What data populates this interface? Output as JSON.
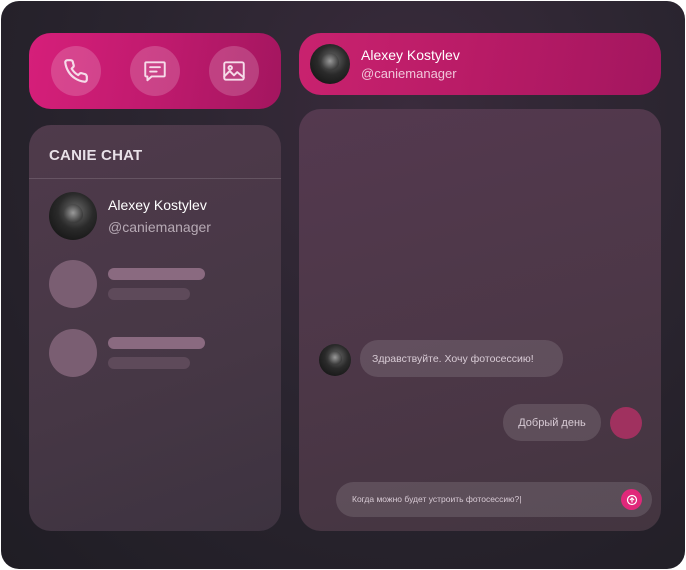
{
  "colors": {
    "accent": "#d61f7a",
    "send": "#e0287a",
    "panel": "#4c3747",
    "background": "#1f1d24"
  },
  "actions": [
    {
      "icon": "phone-icon"
    },
    {
      "icon": "message-icon"
    },
    {
      "icon": "image-icon"
    }
  ],
  "sidebar": {
    "title": "CANIE CHAT",
    "contacts": [
      {
        "name": "Alexey Kostylev",
        "handle": "@caniemanager"
      }
    ]
  },
  "header": {
    "name": "Alexey Kostylev",
    "handle": "@caniemanager"
  },
  "chat": {
    "messages": [
      {
        "direction": "incoming",
        "text": "Здравствуйте. Хочу фотосессию!"
      },
      {
        "direction": "outgoing",
        "text": "Добрый день"
      }
    ],
    "composer": {
      "value": "Когда можно будет устроить фотосессию?|"
    }
  }
}
